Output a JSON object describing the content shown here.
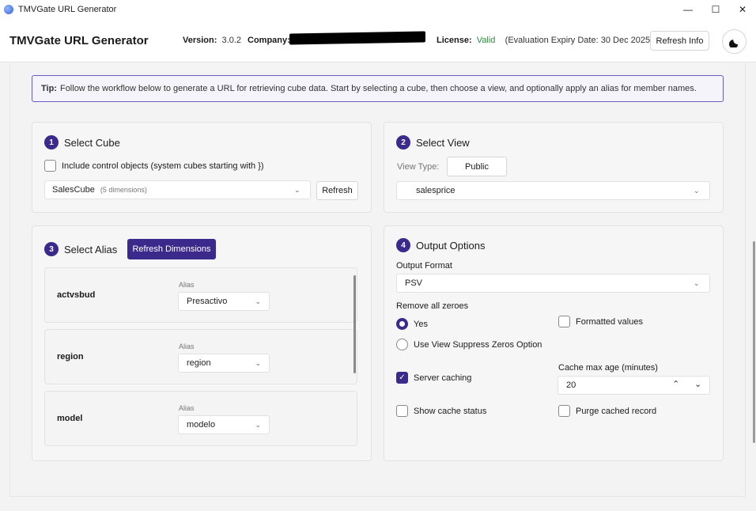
{
  "window": {
    "title": "TMVGate URL Generator",
    "minimize_glyph": "—",
    "maximize_glyph": "☐",
    "close_glyph": "✕"
  },
  "header": {
    "app_title": "TMVGate URL Generator",
    "version_label": "Version:",
    "version_value": "3.0.2",
    "company_label": "Company:",
    "license_label": "License:",
    "license_status": "Valid",
    "license_expiry": "(Evaluation Expiry Date: 30 Dec 2025)",
    "refresh_info_label": "Refresh Info",
    "theme_icon": "moon-icon"
  },
  "tip": {
    "prefix": "Tip:",
    "text": "Follow the workflow below to generate a URL for retrieving cube data. Start by selecting a cube, then choose a view, and optionally apply an alias for member names."
  },
  "select_cube": {
    "step": "1",
    "title": "Select Cube",
    "include_control_label": "Include control objects (system cubes starting with })",
    "include_control_checked": false,
    "cube_value": "SalesCube",
    "cube_hint": "(5 dimensions)",
    "refresh_label": "Refresh"
  },
  "select_view": {
    "step": "2",
    "title": "Select View",
    "view_type_label": "View Type:",
    "view_type_value": "Public",
    "view_value": "salesprice"
  },
  "select_alias": {
    "step": "3",
    "title": "Select Alias",
    "refresh_dimensions_label": "Refresh Dimensions",
    "alias_field_label": "Alias",
    "dimensions": [
      {
        "name": "actvsbud",
        "alias": "Presactivo"
      },
      {
        "name": "region",
        "alias": "region"
      },
      {
        "name": "model",
        "alias": "modelo"
      }
    ]
  },
  "output_options": {
    "step": "4",
    "title": "Output Options",
    "format_label": "Output Format",
    "format_value": "PSV",
    "remove_zeroes_label": "Remove all zeroes",
    "zero_options": [
      {
        "label": "Yes",
        "checked": true
      },
      {
        "label": "Use View Suppress Zeros Option",
        "checked": false
      }
    ],
    "formatted_values_label": "Formatted values",
    "formatted_values_checked": false,
    "server_caching_label": "Server caching",
    "server_caching_checked": true,
    "cache_max_age_label": "Cache max age (minutes)",
    "cache_max_age_value": "20",
    "show_cache_status_label": "Show cache status",
    "show_cache_status_checked": false,
    "purge_cached_label": "Purge cached record",
    "purge_cached_checked": false
  },
  "colors": {
    "accent": "#3b2a8c",
    "valid": "#2e8b3c",
    "tip_border": "#6b5bc0"
  }
}
